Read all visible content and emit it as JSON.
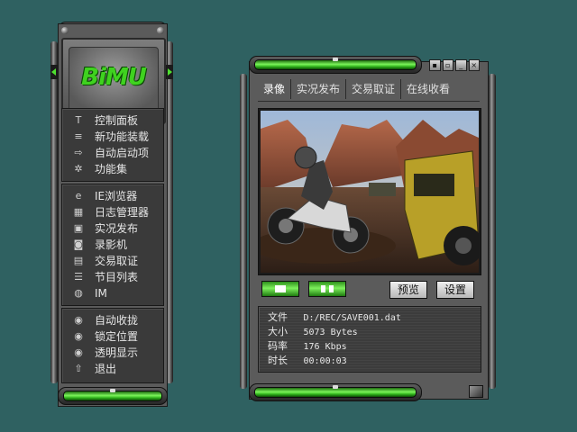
{
  "left_panel": {
    "logo_text": "BiMU",
    "groups": [
      {
        "items": [
          {
            "label": "控制面板",
            "icon": "hammer-icon",
            "glyph": "T"
          },
          {
            "label": "新功能装载",
            "icon": "document-icon",
            "glyph": "≡"
          },
          {
            "label": "自动启动项",
            "icon": "exit-arrow-icon",
            "glyph": "⇨"
          },
          {
            "label": "功能集",
            "icon": "gear-icon",
            "glyph": "✲"
          }
        ]
      },
      {
        "items": [
          {
            "label": "IE浏览器",
            "icon": "ie-icon",
            "glyph": "e"
          },
          {
            "label": "日志管理器",
            "icon": "grid-icon",
            "glyph": "▦"
          },
          {
            "label": "实况发布",
            "icon": "broadcast-icon",
            "glyph": "▣"
          },
          {
            "label": "录影机",
            "icon": "camera-icon",
            "glyph": "◙"
          },
          {
            "label": "交易取证",
            "icon": "certificate-icon",
            "glyph": "▤"
          },
          {
            "label": "节目列表",
            "icon": "list-icon",
            "glyph": "☰"
          },
          {
            "label": "IM",
            "icon": "im-icon",
            "glyph": "◍"
          }
        ]
      },
      {
        "items": [
          {
            "label": "自动收拢",
            "icon": "radio-icon",
            "glyph": "◉"
          },
          {
            "label": "锁定位置",
            "icon": "radio-icon",
            "glyph": "◉"
          },
          {
            "label": "透明显示",
            "icon": "radio-icon",
            "glyph": "◉"
          },
          {
            "label": "退出",
            "icon": "exit-icon",
            "glyph": "⇧"
          }
        ]
      }
    ]
  },
  "main_window": {
    "title_controls": [
      "lock-icon",
      "restore-icon",
      "minimize-icon",
      "close-icon"
    ],
    "tabs": [
      "录像",
      "实况发布",
      "交易取证",
      "在线收看"
    ],
    "active_tab": "录像",
    "buttons": {
      "preview": "预览",
      "settings": "设置"
    },
    "info": {
      "file_label": "文件",
      "file_value": "D:/REC/SAVE001.dat",
      "size_label": "大小",
      "size_value": "5073 Bytes",
      "bitrate_label": "码率",
      "bitrate_value": "176 Kbps",
      "duration_label": "时长",
      "duration_value": "00:00:03"
    }
  },
  "colors": {
    "background": "#2f6161",
    "accent_green": "#4fe030",
    "panel": "#5b5b5b"
  }
}
